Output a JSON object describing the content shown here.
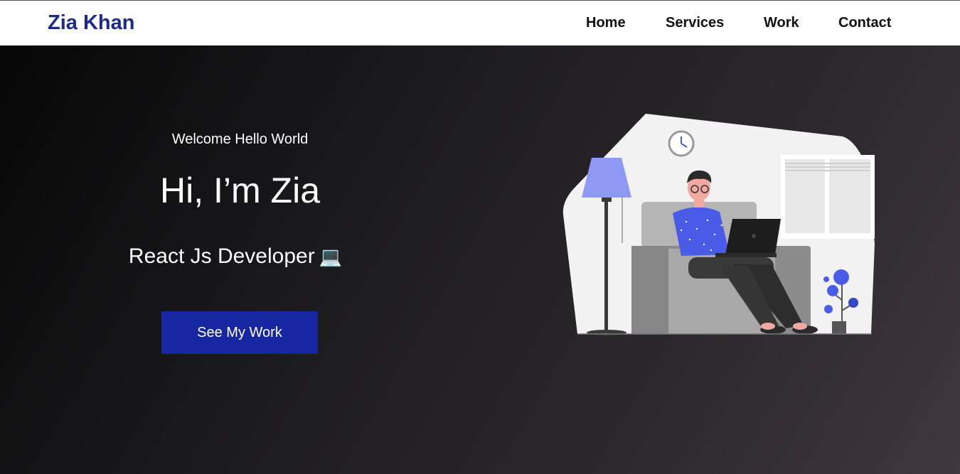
{
  "header": {
    "logo": "Zia Khan",
    "nav": [
      {
        "label": "Home"
      },
      {
        "label": "Services"
      },
      {
        "label": "Work"
      },
      {
        "label": "Contact"
      }
    ]
  },
  "hero": {
    "welcome": "Welcome Hello World",
    "title": "Hi, I’m Zia",
    "role": "React Js Developer",
    "role_icon": "💻",
    "cta_label": "See My Work"
  },
  "colors": {
    "brand": "#1c2a8f",
    "button": "#1727a1",
    "accent": "#4a5be8",
    "hero_bg_start": "#070707",
    "hero_bg_end": "#3f383f"
  }
}
